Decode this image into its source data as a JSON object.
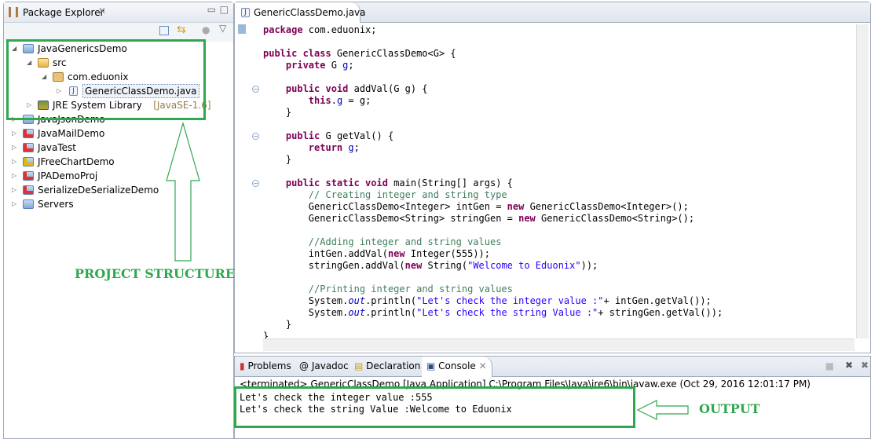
{
  "explorer": {
    "title": "Package Explorer",
    "tree": [
      {
        "label": "JavaGenericsDemo",
        "expanded": true,
        "icon": "project-folder-icon"
      },
      {
        "label": "src",
        "expanded": true,
        "icon": "source-folder-icon"
      },
      {
        "label": "com.eduonix",
        "expanded": true,
        "icon": "package-icon"
      },
      {
        "label": "GenericClassDemo.java",
        "expanded": false,
        "icon": "java-file-icon"
      },
      {
        "label": "JRE System Library",
        "suffix": "[JavaSE-1.6]",
        "icon": "library-icon"
      },
      {
        "label": "JavaJsonDemo",
        "icon": "project-folder-icon"
      },
      {
        "label": "JavaMailDemo",
        "icon": "project-error-icon"
      },
      {
        "label": "JavaTest",
        "icon": "project-error-icon"
      },
      {
        "label": "JFreeChartDemo",
        "icon": "project-warning-icon"
      },
      {
        "label": "JPADemoProj",
        "icon": "project-error-icon"
      },
      {
        "label": "SerializeDeSerializeDemo",
        "icon": "project-error-icon"
      },
      {
        "label": "Servers",
        "icon": "project-folder-icon"
      }
    ]
  },
  "editor": {
    "tab": "GenericClassDemo.java",
    "lines": [
      [
        [
          "k",
          "package"
        ],
        [
          "t",
          " com.eduonix;"
        ]
      ],
      [],
      [
        [
          "k",
          "public class"
        ],
        [
          "t",
          " GenericClassDemo<G> {"
        ]
      ],
      [
        [
          "t",
          "    "
        ],
        [
          "k",
          "private"
        ],
        [
          "t",
          " G "
        ],
        [
          "f",
          "g"
        ],
        [
          "t",
          ";"
        ]
      ],
      [],
      [
        [
          "t",
          "    "
        ],
        [
          "k",
          "public void"
        ],
        [
          "t",
          " addVal(G g) {"
        ]
      ],
      [
        [
          "t",
          "        "
        ],
        [
          "k",
          "this"
        ],
        [
          "t",
          "."
        ],
        [
          "f",
          "g"
        ],
        [
          "t",
          " = g;"
        ]
      ],
      [
        [
          "t",
          "    }"
        ]
      ],
      [],
      [
        [
          "t",
          "    "
        ],
        [
          "k",
          "public"
        ],
        [
          "t",
          " G getVal() {"
        ]
      ],
      [
        [
          "t",
          "        "
        ],
        [
          "k",
          "return"
        ],
        [
          "t",
          " "
        ],
        [
          "f",
          "g"
        ],
        [
          "t",
          ";"
        ]
      ],
      [
        [
          "t",
          "    }"
        ]
      ],
      [],
      [
        [
          "t",
          "    "
        ],
        [
          "k",
          "public static void"
        ],
        [
          "t",
          " main(String[] args) {"
        ]
      ],
      [
        [
          "t",
          "        "
        ],
        [
          "c",
          "// Creating integer and string type"
        ]
      ],
      [
        [
          "t",
          "        GenericClassDemo<Integer> intGen = "
        ],
        [
          "k",
          "new"
        ],
        [
          "t",
          " GenericClassDemo<Integer>();"
        ]
      ],
      [
        [
          "t",
          "        GenericClassDemo<String> stringGen = "
        ],
        [
          "k",
          "new"
        ],
        [
          "t",
          " GenericClassDemo<String>();"
        ]
      ],
      [],
      [
        [
          "t",
          "        "
        ],
        [
          "c",
          "//Adding integer and string values"
        ]
      ],
      [
        [
          "t",
          "        intGen.addVal("
        ],
        [
          "k",
          "new"
        ],
        [
          "t",
          " Integer(555));"
        ]
      ],
      [
        [
          "t",
          "        stringGen.addVal("
        ],
        [
          "k",
          "new"
        ],
        [
          "t",
          " String("
        ],
        [
          "s",
          "\"Welcome to Eduonix\""
        ],
        [
          "t",
          "));"
        ]
      ],
      [],
      [
        [
          "t",
          "        "
        ],
        [
          "c",
          "//Printing integer and string values"
        ]
      ],
      [
        [
          "t",
          "        System."
        ],
        [
          "fi",
          "out"
        ],
        [
          "t",
          ".println("
        ],
        [
          "s",
          "\"Let's check the integer value :\""
        ],
        [
          "t",
          "+ intGen.getVal());"
        ]
      ],
      [
        [
          "t",
          "        System."
        ],
        [
          "fi",
          "out"
        ],
        [
          "t",
          ".println("
        ],
        [
          "s",
          "\"Let's check the string Value :\""
        ],
        [
          "t",
          "+ stringGen.getVal());"
        ]
      ],
      [
        [
          "t",
          "    }"
        ]
      ],
      [
        [
          "t",
          "}"
        ]
      ]
    ]
  },
  "console": {
    "tabs": [
      "Problems",
      "Javadoc",
      "Declaration",
      "Console"
    ],
    "active": "Console",
    "status": "<terminated> GenericClassDemo [Java Application] C:\\Program Files\\Java\\jre6\\bin\\javaw.exe (Oct 29, 2016 12:01:17 PM)",
    "output": [
      "Let's check the integer value :555",
      "Let's check the string Value :Welcome to Eduonix"
    ]
  },
  "annotations": {
    "project": "PROJECT STRUCTURE",
    "output": "OUTPUT",
    "color": "#2fa84f"
  }
}
